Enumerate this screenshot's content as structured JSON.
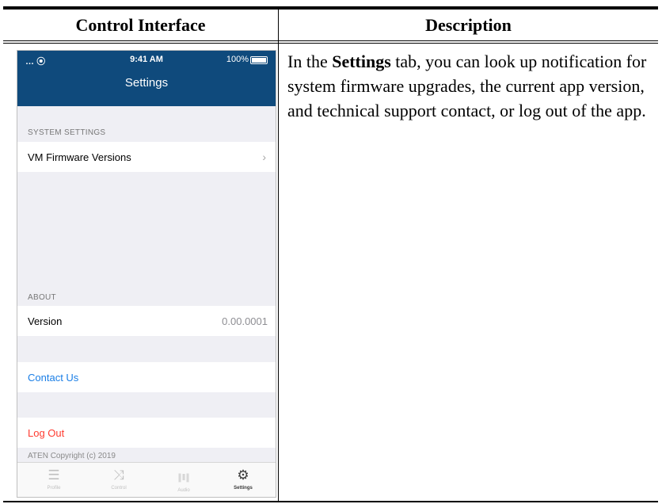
{
  "table": {
    "headers": [
      "Control Interface",
      "Description"
    ]
  },
  "description": {
    "before": "In the ",
    "bold": "Settings",
    "after": " tab, you can look up notification for system firmware upgrades, the current app version, and technical support contact, or log out of the app."
  },
  "phone": {
    "status": {
      "signal": "… ⦿",
      "time": "9:41 AM",
      "battery": "100%"
    },
    "title": "Settings",
    "sections": {
      "system_settings": "SYSTEM SETTINGS",
      "about": "ABOUT"
    },
    "rows": {
      "firmware": {
        "label": "VM Firmware Versions",
        "chevron": "›"
      },
      "version": {
        "label": "Version",
        "value": "0.00.0001"
      },
      "contact": {
        "label": "Contact Us"
      },
      "logout": {
        "label": "Log Out"
      }
    },
    "copyright": "ATEN Copyright (c) 2019",
    "tabs": [
      {
        "label": "Profile",
        "icon": "list-icon",
        "glyph": "☰"
      },
      {
        "label": "Control",
        "icon": "shuffle-icon",
        "glyph": "⤨"
      },
      {
        "label": "Audio",
        "icon": "waveform-icon",
        "glyph": "∥‖∥"
      },
      {
        "label": "Settings",
        "icon": "gear-icon",
        "glyph": "⚙"
      }
    ],
    "colors": {
      "navbar": "#0f4a7c",
      "link": "#1a7ee6",
      "destructive": "#ff3b30",
      "background": "#efeff4"
    }
  }
}
